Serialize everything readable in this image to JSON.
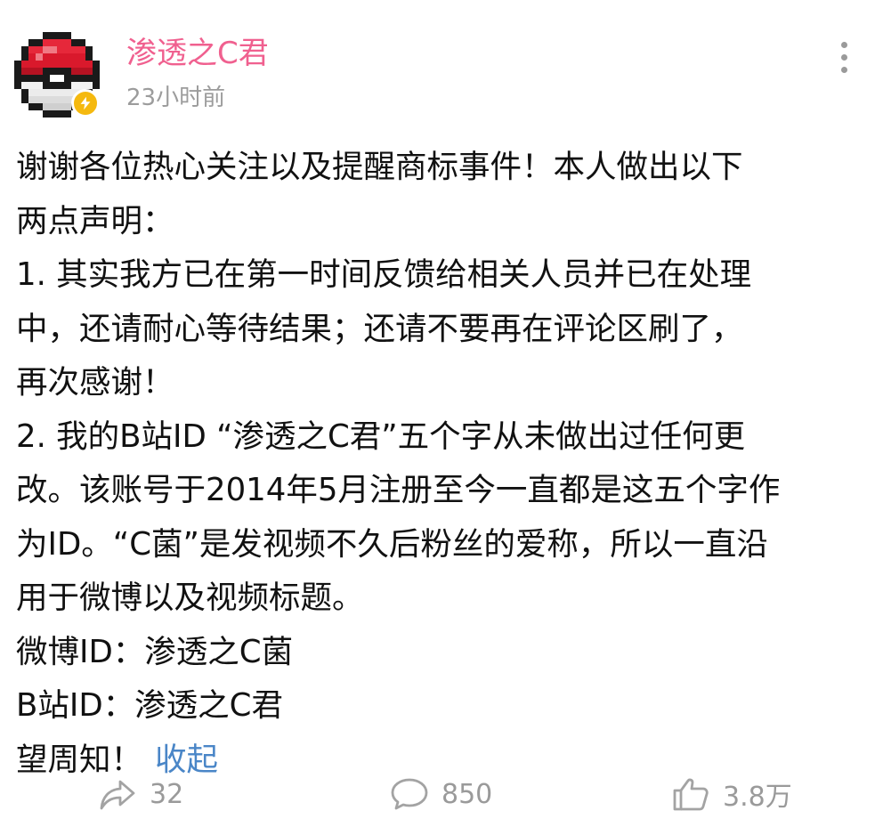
{
  "author": {
    "name": "渗透之C君",
    "time": "23小时前"
  },
  "content": {
    "lines": [
      "谢谢各位热心关注以及提醒商标事件！本人做出以下",
      "两点声明：",
      "1. 其实我方已在第一时间反馈给相关人员并已在处理",
      "中，还请耐心等待结果；还请不要再在评论区刷了，",
      "再次感谢！",
      "2. 我的B站ID “渗透之C君”五个字从未做出过任何更",
      "改。该账号于2014年5月注册至今一直都是这五个字作",
      "为ID。“C菌”是发视频不久后粉丝的爱称，所以一直沿",
      "用于微博以及视频标题。",
      "微博ID：渗透之C菌",
      "B站ID：渗透之C君",
      "望周知！"
    ],
    "collapse_label": "收起"
  },
  "actions": {
    "share_count": "32",
    "comment_count": "850",
    "like_count": "3.8万"
  },
  "colors": {
    "author": "#f0608f",
    "link": "#4a86c7",
    "muted": "#9c9c9c",
    "badge": "#f5b90f"
  },
  "icons": {
    "avatar": "pixel-pokeball-avatar",
    "badge": "lightning-badge-icon",
    "more": "more-vertical-icon",
    "share": "share-arrow-icon",
    "comment": "comment-bubble-icon",
    "like": "thumbs-up-icon"
  }
}
